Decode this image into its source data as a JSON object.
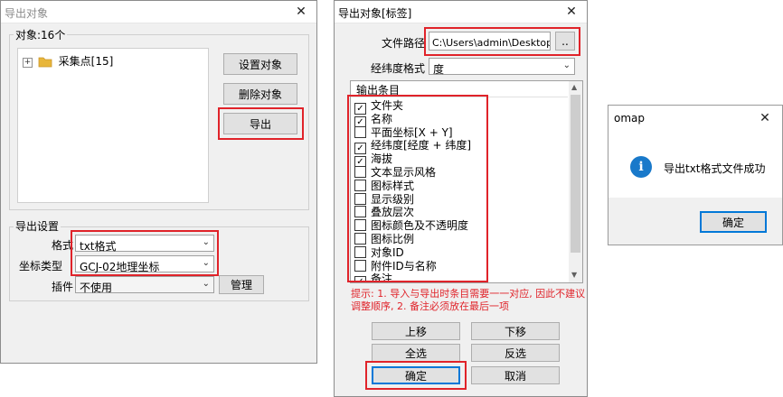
{
  "dlg1": {
    "title": "导出对象",
    "objects_label": "对象:16个",
    "tree_node": "采集点[15]",
    "tree_expander": "+",
    "btn_set": "设置对象",
    "btn_delete": "删除对象",
    "btn_export": "导出",
    "export_settings_label": "导出设置",
    "format_label": "格式",
    "format_value": "txt格式",
    "coord_label": "坐标类型",
    "coord_value": "GCJ-02地理坐标",
    "plugin_label": "插件",
    "plugin_value": "不使用",
    "btn_manage": "管理"
  },
  "dlg2": {
    "title": "导出对象[标签]",
    "path_label": "文件路径",
    "path_value": "C:\\Users\\admin\\Desktop\\采集",
    "browse_label": "..",
    "latlon_label": "经纬度格式",
    "latlon_value": "度",
    "list_header": "输出条目",
    "items": [
      {
        "label": "文件夹",
        "checked": true
      },
      {
        "label": "名称",
        "checked": true
      },
      {
        "label": "平面坐标[X + Y]",
        "checked": false
      },
      {
        "label": "经纬度[经度 + 纬度]",
        "checked": true
      },
      {
        "label": "海拔",
        "checked": true
      },
      {
        "label": "文本显示风格",
        "checked": false
      },
      {
        "label": "图标样式",
        "checked": false
      },
      {
        "label": "显示级别",
        "checked": false
      },
      {
        "label": "叠放层次",
        "checked": false
      },
      {
        "label": "图标颜色及不透明度",
        "checked": false
      },
      {
        "label": "图标比例",
        "checked": false
      },
      {
        "label": "对象ID",
        "checked": false
      },
      {
        "label": "附件ID与名称",
        "checked": false
      },
      {
        "label": "备注",
        "checked": true
      }
    ],
    "hint_line1": "提示: 1. 导入与导出时条目需要一一对应, 因此不建议",
    "hint_line2": "调整顺序, 2. 备注必须放在最后一项",
    "btn_up": "上移",
    "btn_down": "下移",
    "btn_select_all": "全选",
    "btn_invert": "反选",
    "btn_ok": "确定",
    "btn_cancel": "取消"
  },
  "dlg3": {
    "title": "omap",
    "message": "导出txt格式文件成功",
    "btn_ok": "确定"
  },
  "glyphs": {
    "close": "✕",
    "dropdown": "⌄",
    "check": "✓",
    "scroll_up": "▲",
    "scroll_down": "▼",
    "info": "i"
  },
  "colors": {
    "highlight_red": "#e0232a",
    "hint_red": "#e0232a",
    "info_blue": "#1979ca",
    "folder_yellow": "#e8b63a"
  }
}
